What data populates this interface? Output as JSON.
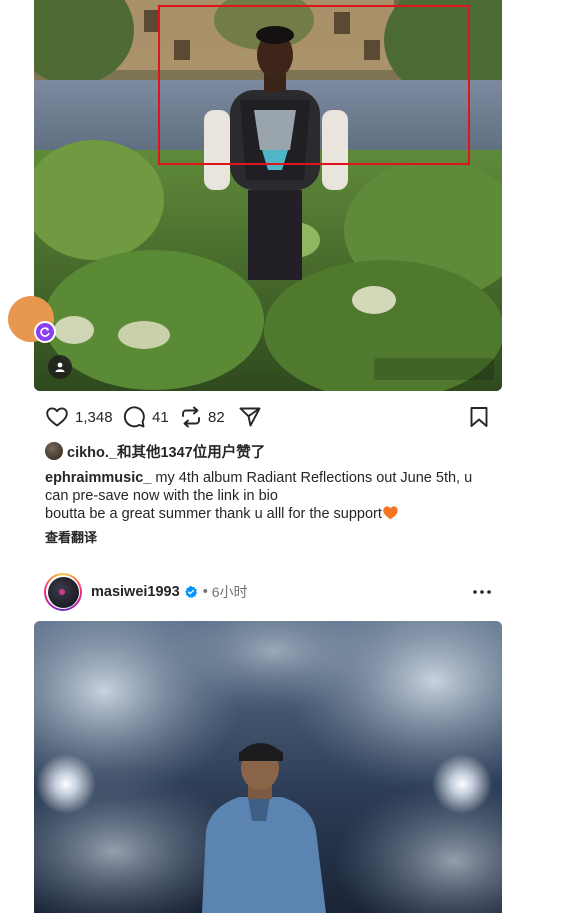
{
  "post1": {
    "actions": {
      "like_count": "1,348",
      "comment_count": "41",
      "repost_count": "82"
    },
    "likes_text": "cikho._和其他1347位用户赞了",
    "caption": {
      "username": "ephraimmusic_",
      "line1": " my 4th album Radiant Reflections out June 5th, u can pre-save now with the link in bio",
      "line2": "boutta be a great summer thank u alll for the support"
    },
    "translate_label": "查看翻译"
  },
  "post2": {
    "username": "masiwei1993",
    "separator": "•",
    "time": "6小时"
  },
  "icons": {
    "like": "heart-icon",
    "comment": "comment-icon",
    "repost": "repost-icon",
    "share": "send-icon",
    "save": "bookmark-icon",
    "verified": "verified-badge-icon",
    "more": "more-horizontal-icon"
  },
  "colors": {
    "text": "#262626",
    "muted": "#737373",
    "verified": "#0095f6",
    "highlight": "#e0141b",
    "floating_avatar": "#e8974f",
    "badge": "#8a3ff0"
  }
}
